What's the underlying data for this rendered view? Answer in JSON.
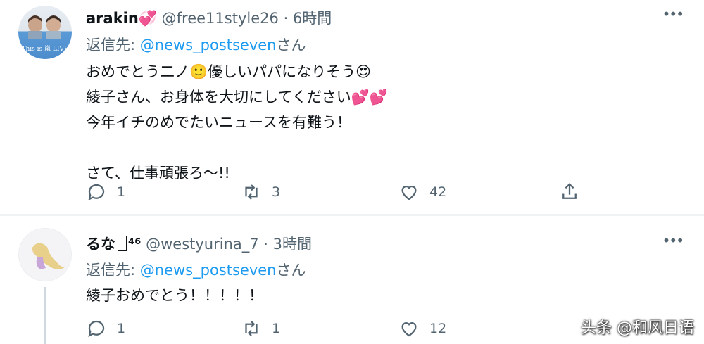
{
  "tweets": [
    {
      "display_name": "arakin",
      "name_emoji": "💞",
      "handle": "@free11style26",
      "sep": "·",
      "time": "6時間",
      "more": "•••",
      "reply_prefix": "返信先: ",
      "reply_handle": "@news_postseven",
      "reply_suffix": "さん",
      "body": "おめでとう二ノ🙂優しいパパになりそう😍\n綾子さん、お身体を大切にしてください💕💕\n今年イチのめでたいニュースを有難う！\n\nさて、仕事頑張ろ〜!!",
      "avatar_text": "This is 嵐 LIVE",
      "replies": "1",
      "retweets": "3",
      "likes": "42"
    },
    {
      "display_name": "るな",
      "name_emoji": "",
      "name_suffix": "⁴⁶",
      "handle": "@westyurina_7",
      "sep": "·",
      "time": "3時間",
      "more": "•••",
      "reply_prefix": "返信先: ",
      "reply_handle": "@news_postseven",
      "reply_suffix": "さん",
      "body": "綾子おめでとう！！！！！",
      "replies": "1",
      "retweets": "1",
      "likes": "12"
    }
  ],
  "watermark": "头条 @和风日语",
  "colors": {
    "link": "#1d9bf0",
    "muted": "#536471",
    "text": "#0f1419"
  }
}
